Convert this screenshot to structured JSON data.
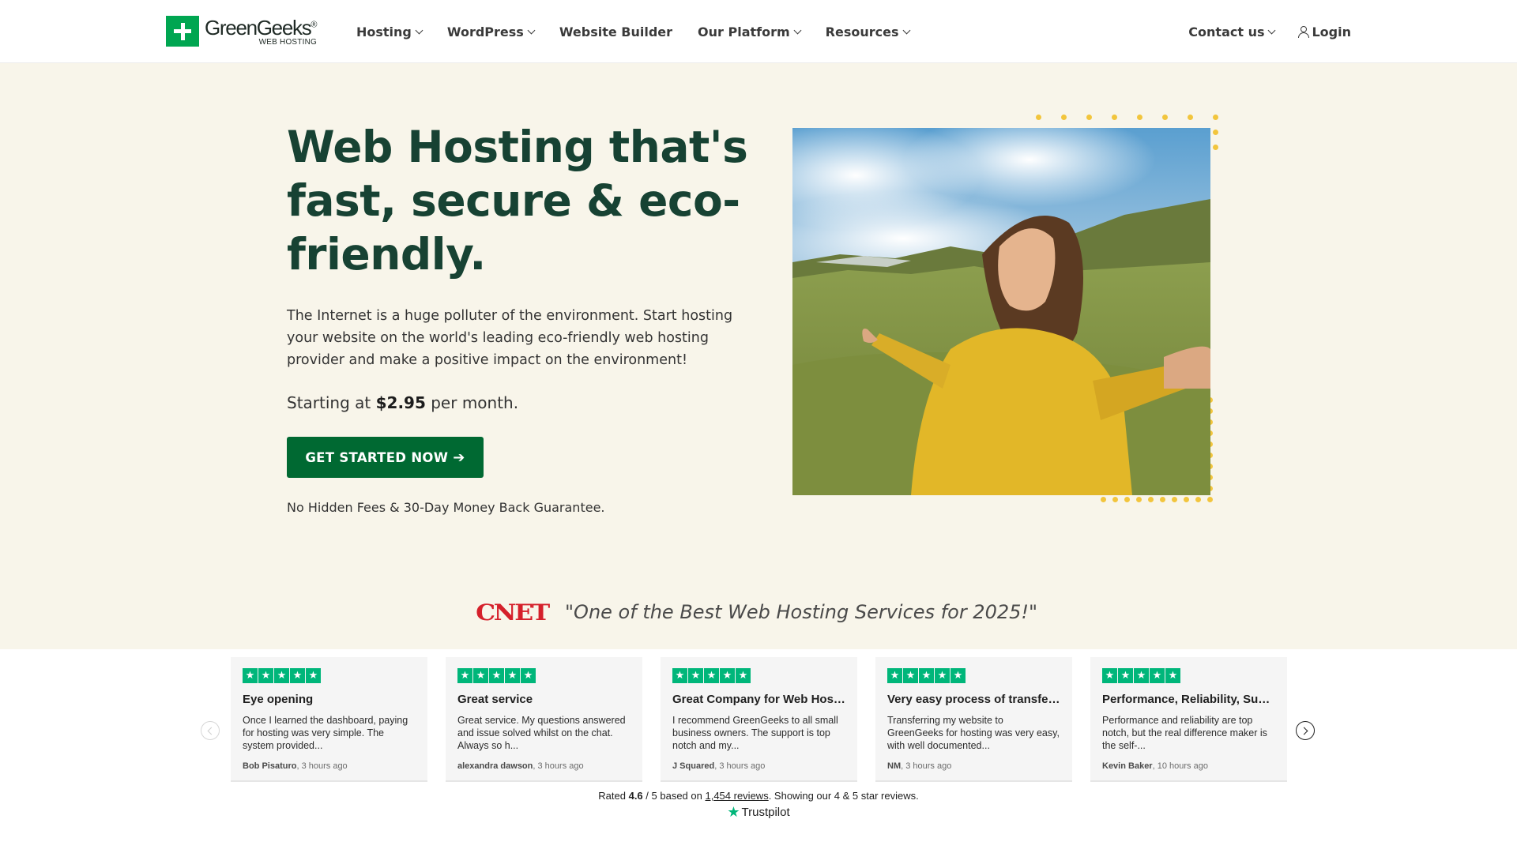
{
  "header": {
    "logo": {
      "name": "GreenGeeks",
      "registered": "®",
      "sub": "WEB HOSTING"
    },
    "nav": [
      {
        "label": "Hosting",
        "dropdown": true
      },
      {
        "label": "WordPress",
        "dropdown": true
      },
      {
        "label": "Website Builder",
        "dropdown": false
      },
      {
        "label": "Our Platform",
        "dropdown": true
      },
      {
        "label": "Resources",
        "dropdown": true
      }
    ],
    "contact_label": "Contact us",
    "login_label": "Login"
  },
  "hero": {
    "title": "Web Hosting that's fast, secure & eco-friendly.",
    "description": "The Internet is a huge polluter of the environment. Start hosting your website on the world's leading eco-friendly web hosting provider and make a positive impact on the environment!",
    "price_prefix": "Starting at",
    "price": "$2.95",
    "price_suffix": "per month.",
    "cta_label": "GET STARTED NOW",
    "cta_icon": "arrow-right-icon",
    "guarantee": "No Hidden Fees & 30-Day Money Back Guarantee.",
    "photo_alt": "woman-in-yellow-jacket-in-green-mountains"
  },
  "press": {
    "logo": "CNET",
    "quote": "\"One of the Best Web Hosting Services for 2025!\""
  },
  "reviews": {
    "items": [
      {
        "title": "Eye opening",
        "text": "Once I learned the dashboard, paying for hosting was very simple. The system provided...",
        "author": "Bob Pisaturo",
        "time": "3 hours ago",
        "stars": 5
      },
      {
        "title": "Great service",
        "text": "Great service. My questions answered and issue solved whilst on the chat. Always so h...",
        "author": "alexandra dawson",
        "time": "3 hours ago",
        "stars": 5
      },
      {
        "title": "Great Company for Web Hosti...",
        "text": "I recommend GreenGeeks to all small business owners. The support is top notch and my...",
        "author": "J Squared",
        "time": "3 hours ago",
        "stars": 5
      },
      {
        "title": "Very easy process of transferr...",
        "text": "Transferring my website to GreenGeeks for hosting was very easy, with well documented...",
        "author": "NM",
        "time": "3 hours ago",
        "stars": 5
      },
      {
        "title": "Performance, Reliability, Supp...",
        "text": "Performance and reliability are top notch, but the real difference maker is the self-...",
        "author": "Kevin Baker",
        "time": "10 hours ago",
        "stars": 5
      }
    ],
    "rating": {
      "prefix": "Rated",
      "score": "4.6",
      "scale": "/ 5 based on",
      "count_link": "1,454 reviews",
      "suffix": ". Showing our 4 & 5 star reviews."
    },
    "brand": "Trustpilot"
  },
  "colors": {
    "brand_green": "#00a651",
    "title_green": "#174233",
    "cta_green": "#006932",
    "hero_bg": "#f8f5ea",
    "dot_yellow": "#f2c53d",
    "cnet_red": "#d5202b",
    "trustpilot_green": "#00b67a"
  }
}
